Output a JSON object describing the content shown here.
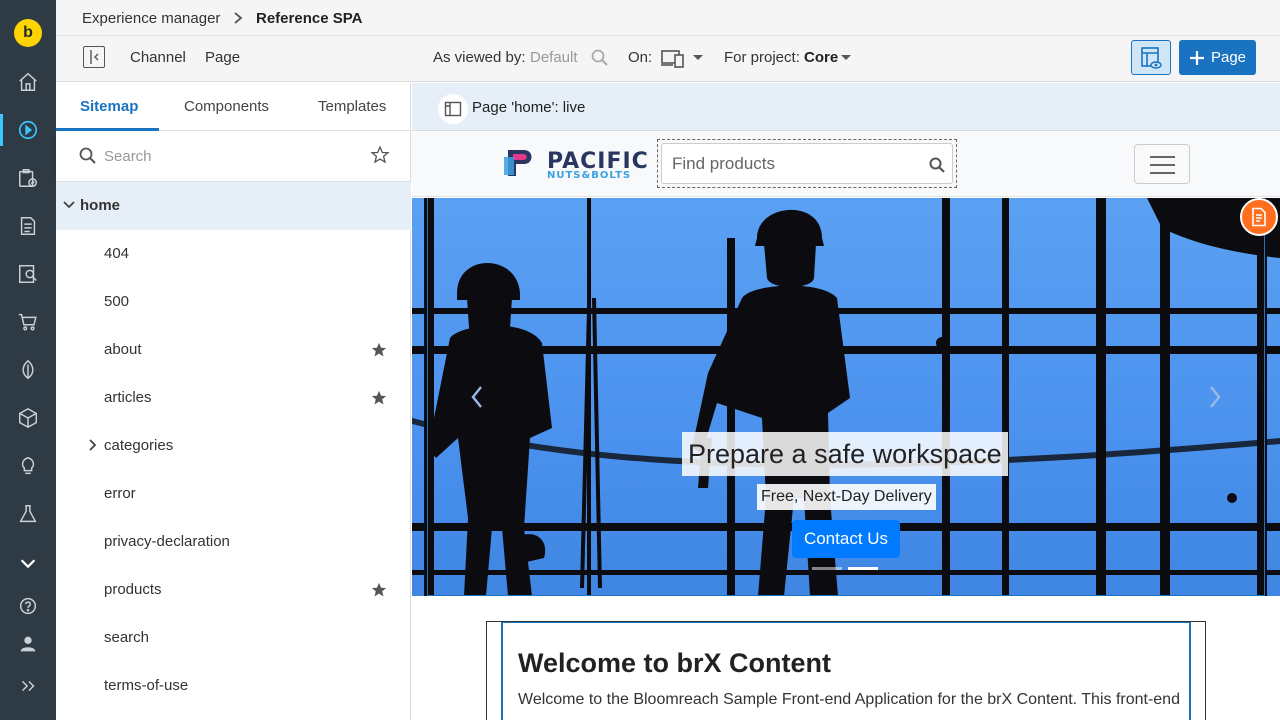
{
  "rail": {
    "logo_letter": "b",
    "items": [
      "home-icon",
      "experience-manager-icon",
      "projects-icon",
      "content-icon",
      "content-search-icon",
      "commerce-icon",
      "categories-icon",
      "components-icon",
      "insights-icon",
      "experiments-icon",
      "more-icon",
      "help-icon",
      "user-icon",
      "expand-icon"
    ]
  },
  "header": {
    "breadcrumb_app": "Experience manager",
    "breadcrumb_channel": "Reference SPA"
  },
  "toolbar": {
    "channel_label": "Channel",
    "page_label": "Page",
    "viewed_by_label": "As viewed by:",
    "viewed_by_value": "Default",
    "on_label": "On:",
    "project_label": "For project:",
    "project_value": "Core",
    "new_page_label": "Page"
  },
  "panel": {
    "tabs": [
      {
        "label": "Sitemap"
      },
      {
        "label": "Components"
      },
      {
        "label": "Templates"
      }
    ],
    "search_placeholder": "Search",
    "tree": [
      {
        "label": "home",
        "starred": false
      },
      {
        "label": "404",
        "starred": false
      },
      {
        "label": "500",
        "starred": false
      },
      {
        "label": "about",
        "starred": true
      },
      {
        "label": "articles",
        "starred": true
      },
      {
        "label": "categories",
        "starred": false
      },
      {
        "label": "error",
        "starred": false
      },
      {
        "label": "privacy-declaration",
        "starred": false
      },
      {
        "label": "products",
        "starred": true
      },
      {
        "label": "search",
        "starred": false
      },
      {
        "label": "terms-of-use",
        "starred": false
      }
    ]
  },
  "canvas": {
    "live_status": "Page 'home': live",
    "site": {
      "brand_name": "PACIFIC",
      "brand_tagline": "NUTS&BOLTS",
      "find_placeholder": "Find products"
    },
    "hero": {
      "title": "Prepare a safe workspace",
      "subtitle": "Free, Next-Day Delivery",
      "cta": "Contact Us",
      "active_slide": 2,
      "slide_count": 2
    },
    "welcome": {
      "heading": "Welcome to brX Content",
      "body": "Welcome to the Bloomreach Sample Front-end Application for the brX Content. This front-end"
    }
  },
  "colors": {
    "rail_bg": "#2e3a44",
    "accent": "#1a73c1",
    "logo_yellow": "#ffd500",
    "cta_blue": "#007bff",
    "edit_badge": "#ff6f1f"
  }
}
